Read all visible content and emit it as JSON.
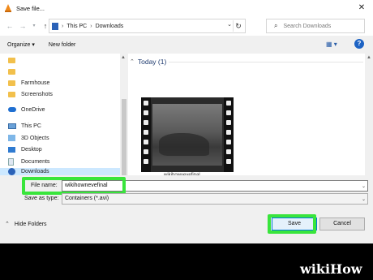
{
  "window": {
    "title": "Save file..."
  },
  "address": {
    "crumbs": [
      "This PC",
      "Downloads"
    ],
    "search_placeholder": "Search Downloads"
  },
  "toolbar": {
    "organize": "Organize ▾",
    "new_folder": "New folder"
  },
  "sidebar": {
    "items": [
      {
        "label": "",
        "icon": "folder-icon"
      },
      {
        "label": "",
        "icon": "folder-icon"
      },
      {
        "label": "Farmhouse",
        "icon": "folder-icon"
      },
      {
        "label": "Screenshots",
        "icon": "folder-icon"
      },
      {
        "label": "OneDrive",
        "icon": "cloud-icon"
      },
      {
        "label": "This PC",
        "icon": "computer-icon"
      },
      {
        "label": "3D Objects",
        "icon": "cube-icon"
      },
      {
        "label": "Desktop",
        "icon": "desktop-icon"
      },
      {
        "label": "Documents",
        "icon": "document-icon"
      },
      {
        "label": "Downloads",
        "icon": "download-icon"
      }
    ]
  },
  "content": {
    "group_label": "Today (1)",
    "thumbnail_caption": "wikihowvevefinal"
  },
  "form": {
    "filename_label": "File name:",
    "filename_value": "wikihownevefinal",
    "savetype_label": "Save as type:",
    "savetype_value": "Containers (*.avi)"
  },
  "footer": {
    "hide_folders": "Hide Folders",
    "save": "Save",
    "cancel": "Cancel"
  },
  "watermark": {
    "wiki": "wiki",
    "how": "How"
  },
  "colors": {
    "highlight": "#39e53c",
    "accent": "#0078d7"
  }
}
